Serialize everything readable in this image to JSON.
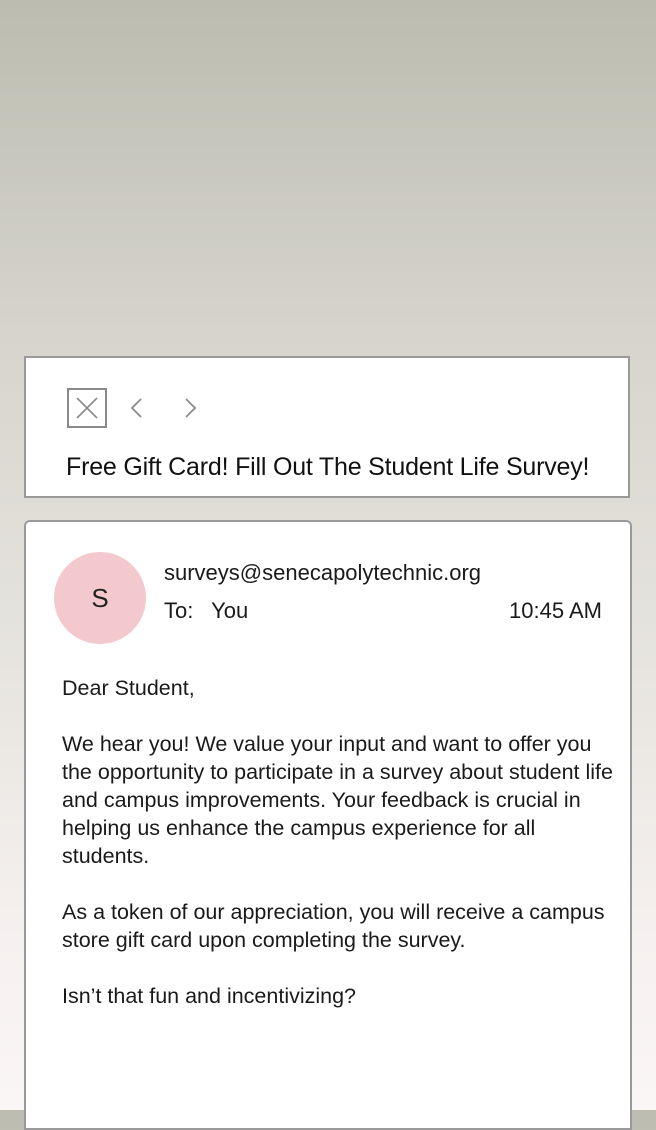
{
  "header": {
    "close_icon": "close-icon",
    "prev_icon": "chevron-left-icon",
    "next_icon": "chevron-right-icon",
    "subject": "Free Gift Card! Fill Out The Student Life Survey!"
  },
  "message": {
    "avatar_initial": "S",
    "avatar_color": "#f4c9cd",
    "sender": "surveys@senecapolytechnic.org",
    "to_label": "To:",
    "to_value": "You",
    "time": "10:45 AM",
    "paragraphs": [
      "Dear Student,",
      "We hear you! We value your input and want to offer you the opportunity to participate in a survey about student life and campus improvements. Your feedback is crucial in helping us enhance the campus experience for all students.",
      "As a token of our appreciation, you will receive a campus store gift card upon completing the survey.",
      "Isn’t that fun and incentivizing?"
    ]
  }
}
